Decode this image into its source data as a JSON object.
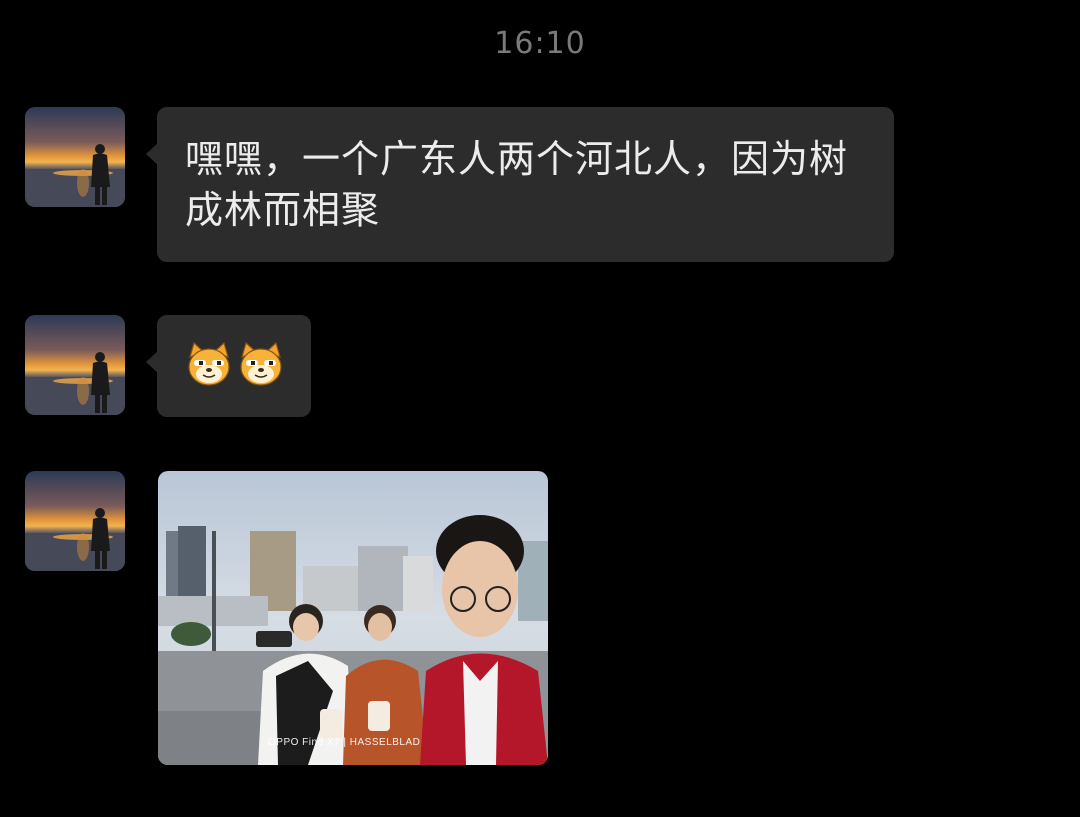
{
  "chat": {
    "timestamp": "16:10",
    "messages": [
      {
        "type": "text",
        "text": "嘿嘿，一个广东人两个河北人，因为树成林而相聚"
      },
      {
        "type": "emoji",
        "icons": [
          "doge-cat-emoji",
          "doge-cat-emoji"
        ]
      },
      {
        "type": "image",
        "watermark": "OPPO Find X7 | HASSELBLAD"
      }
    ]
  },
  "colors": {
    "background": "#000000",
    "bubble": "#2c2c2c",
    "bubble_text": "#ececec",
    "timestamp": "#7a7a7a"
  }
}
